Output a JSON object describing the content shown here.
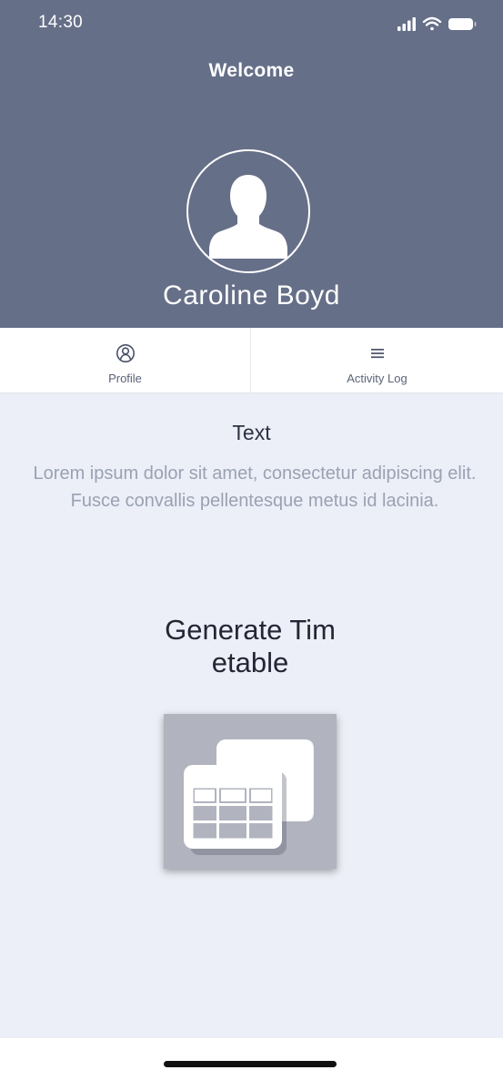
{
  "status_bar": {
    "time": "14:30",
    "icons": [
      "signal-icon",
      "wifi-icon",
      "battery-icon"
    ]
  },
  "header": {
    "title": "Welcome",
    "avatar_icon": "person-silhouette-icon",
    "user_name": "Caroline Boyd",
    "background_color": "#666f88"
  },
  "tabs": [
    {
      "label": "Profile",
      "icon": "profile-icon"
    },
    {
      "label": "Activity Log",
      "icon": "menu-lines-icon"
    }
  ],
  "content": {
    "title": "Text",
    "body": "Lorem ipsum dolor sit amet, consectetur adipiscing elit. Fusce convallis pellentesque metus id lacinia.",
    "generate_label": "Generate Timetable",
    "generate_icon": "timetable-icon",
    "background_color": "#eceff7"
  }
}
